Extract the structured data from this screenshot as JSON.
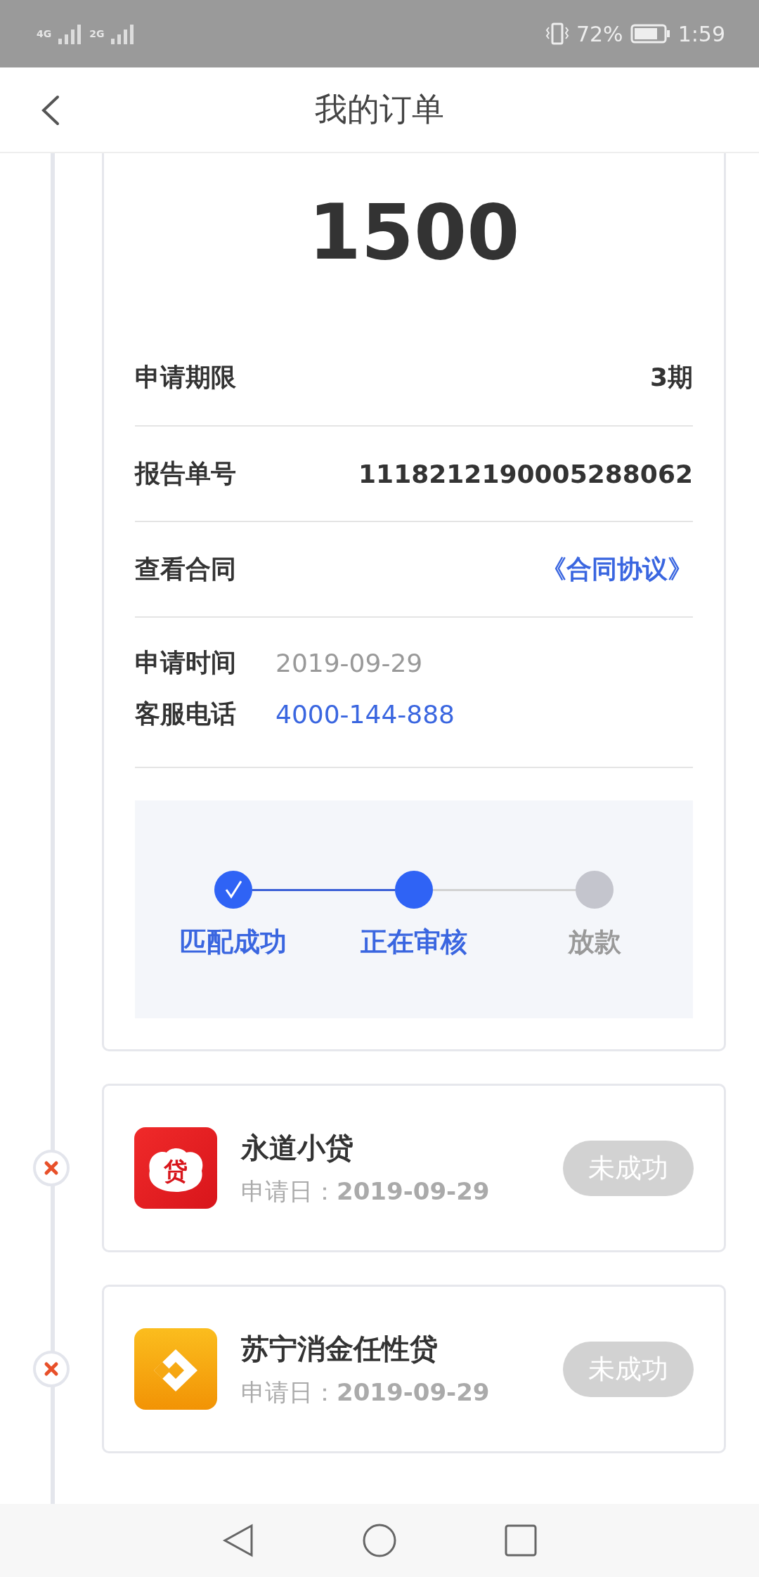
{
  "status_bar": {
    "network_1": "4G",
    "network_2": "2G",
    "battery": "72%",
    "time": "1:59"
  },
  "header": {
    "title": "我的订单"
  },
  "order": {
    "amount": "1500",
    "rows": [
      {
        "kind": "plain",
        "label": "申请期限",
        "value": "3期"
      },
      {
        "kind": "plain",
        "label": "报告单号",
        "value": "1118212190005288062"
      },
      {
        "kind": "link",
        "label": "查看合同",
        "value": "《合同协议》"
      }
    ],
    "info": [
      {
        "kind": "plain",
        "label": "申请时间",
        "value": "2019-09-29"
      },
      {
        "kind": "link",
        "label": "客服电话",
        "value": "4000-144-888"
      }
    ],
    "steps": [
      {
        "label": "匹配成功",
        "done": true,
        "selected": false
      },
      {
        "label": "正在审核",
        "done": false,
        "selected": true
      },
      {
        "label": "放款",
        "done": false,
        "selected": false
      }
    ]
  },
  "applications": [
    {
      "name": "永道小贷",
      "date_label": "申请日：",
      "date": "2019-09-29",
      "status": "未成功",
      "failed": true,
      "kind": "cloud",
      "logo_text": "贷"
    },
    {
      "name": "苏宁消金任性贷",
      "date_label": "申请日：",
      "date": "2019-09-29",
      "status": "未成功",
      "failed": true,
      "kind": "diamond"
    }
  ]
}
